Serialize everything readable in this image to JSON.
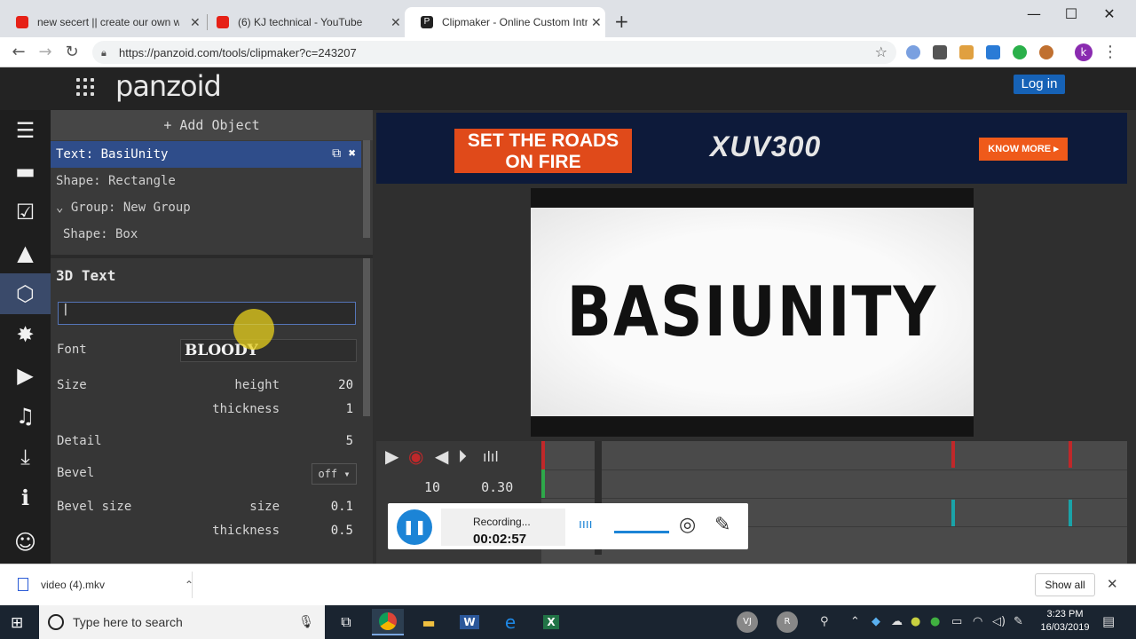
{
  "browser": {
    "tabs": [
      {
        "title": "new secert || create our own web"
      },
      {
        "title": "(6) KJ technical - YouTube"
      },
      {
        "title": "Clipmaker - Online Custom Intro"
      }
    ],
    "new_tab": "+",
    "url": "https://panzoid.com/tools/clipmaker?c=243207",
    "profile_initial": "k",
    "window_controls": {
      "minimize": "—",
      "maximize": "☐",
      "close": "✕"
    }
  },
  "panzoid": {
    "logo": "panzoid",
    "login": "Log in"
  },
  "rail": {
    "icons": [
      "menu-icon",
      "folder-icon",
      "checkbox-icon",
      "mountain-icon",
      "cube-icon",
      "starburst-icon",
      "camera-icon",
      "music-icon",
      "download-icon",
      "info-icon",
      "smiley-icon"
    ]
  },
  "objects": {
    "add_object": "+ Add Object",
    "items": [
      {
        "label": "Text: BasiUnity"
      },
      {
        "label": "Shape: Rectangle"
      },
      {
        "label": "⌄ Group: New Group"
      },
      {
        "label": "Shape: Box"
      }
    ]
  },
  "properties": {
    "section_title": "3D Text",
    "text_value": "",
    "font_label": "Font",
    "font_value": "BLOODY",
    "size_label": "Size",
    "height_label": "height",
    "height_value": "20",
    "thickness_label": "thickness",
    "thickness_value": "1",
    "detail_label": "Detail",
    "detail_value": "5",
    "bevel_label": "Bevel",
    "bevel_value": "off ▾",
    "bevel_size_label": "Bevel size",
    "bevel_size_sub": "size",
    "bevel_size_value": "0.1",
    "bevel_thickness_label": "thickness",
    "bevel_thickness_value": "0.5"
  },
  "ad": {
    "headline": "SET THE ROADS ON FIRE",
    "brand": "XUV300",
    "cta": "KNOW MORE ▸"
  },
  "preview": {
    "text": "BASIUNITY"
  },
  "timeline": {
    "time": "10",
    "position": "0.30",
    "colors": {
      "marker_red": "#c0282a",
      "marker_teal": "#1aa3a8",
      "marker_green": "#2ea84a"
    }
  },
  "recorder": {
    "status": "Recording...",
    "elapsed": "00:02:57"
  },
  "download": {
    "file": "video (4).mkv",
    "show_all": "Show all"
  },
  "taskbar": {
    "search_placeholder": "Type here to search",
    "time": "3:23 PM",
    "date": "16/03/2019",
    "avatars": [
      "VJ",
      "R"
    ]
  }
}
